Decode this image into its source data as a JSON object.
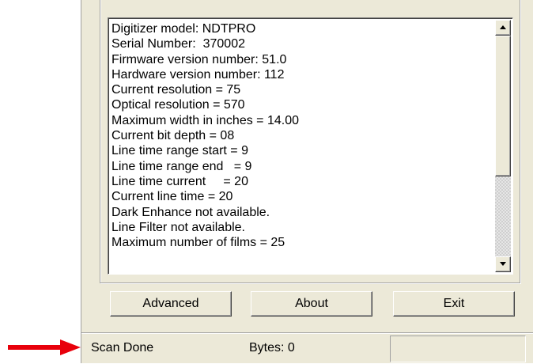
{
  "info_list": {
    "lines": [
      "Digitizer model: NDTPRO",
      "Serial Number:  370002",
      "Firmware version number: 51.0",
      "Hardware version number: 112",
      "Current resolution = 75",
      "Optical resolution = 570",
      "Maximum width in inches = 14.00",
      "Current bit depth = 08",
      "Line time range start = 9",
      "Line time range end   = 9",
      "Line time current     = 20",
      "Current line time = 20",
      "Dark Enhance not available.",
      "Line Filter not available.",
      "Maximum number of films = 25"
    ]
  },
  "buttons": {
    "advanced": "Advanced",
    "about": "About",
    "exit": "Exit"
  },
  "status_bar": {
    "status": "Scan Done",
    "bytes": "Bytes: 0"
  },
  "annotation": {
    "arrow_color": "#e8000b"
  },
  "icons": {
    "scroll_up": "triangle-up-icon",
    "scroll_down": "triangle-down-icon",
    "pointer_arrow": "arrow-right-icon"
  }
}
